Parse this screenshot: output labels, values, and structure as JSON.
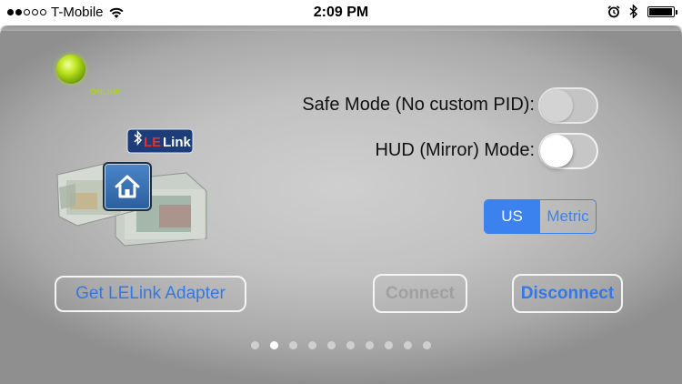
{
  "status_bar": {
    "carrier": "T-Mobile",
    "time": "2:09 PM",
    "signal_bars_filled": 2,
    "signal_bars_total": 5,
    "icons": [
      "wifi-icon",
      "alarm-icon",
      "bluetooth-icon",
      "battery-icon"
    ],
    "battery_level": 0.95
  },
  "device": {
    "status": "ONLINE",
    "brand_badge": "LELink",
    "status_color": "#a8d51e"
  },
  "settings": {
    "safe_mode_label": "Safe Mode (No custom PID):",
    "safe_mode_on": false,
    "hud_mode_label": "HUD (Mirror) Mode:",
    "hud_mode_on": false
  },
  "units": {
    "options": [
      "US",
      "Metric"
    ],
    "selected": "US"
  },
  "buttons": {
    "get_adapter": "Get LELink Adapter",
    "connect": "Connect",
    "disconnect": "Disconnect"
  },
  "pager": {
    "count": 10,
    "current": 2
  },
  "colors": {
    "accent": "#3b82ef",
    "disabled_text": "#a0a0a0"
  }
}
